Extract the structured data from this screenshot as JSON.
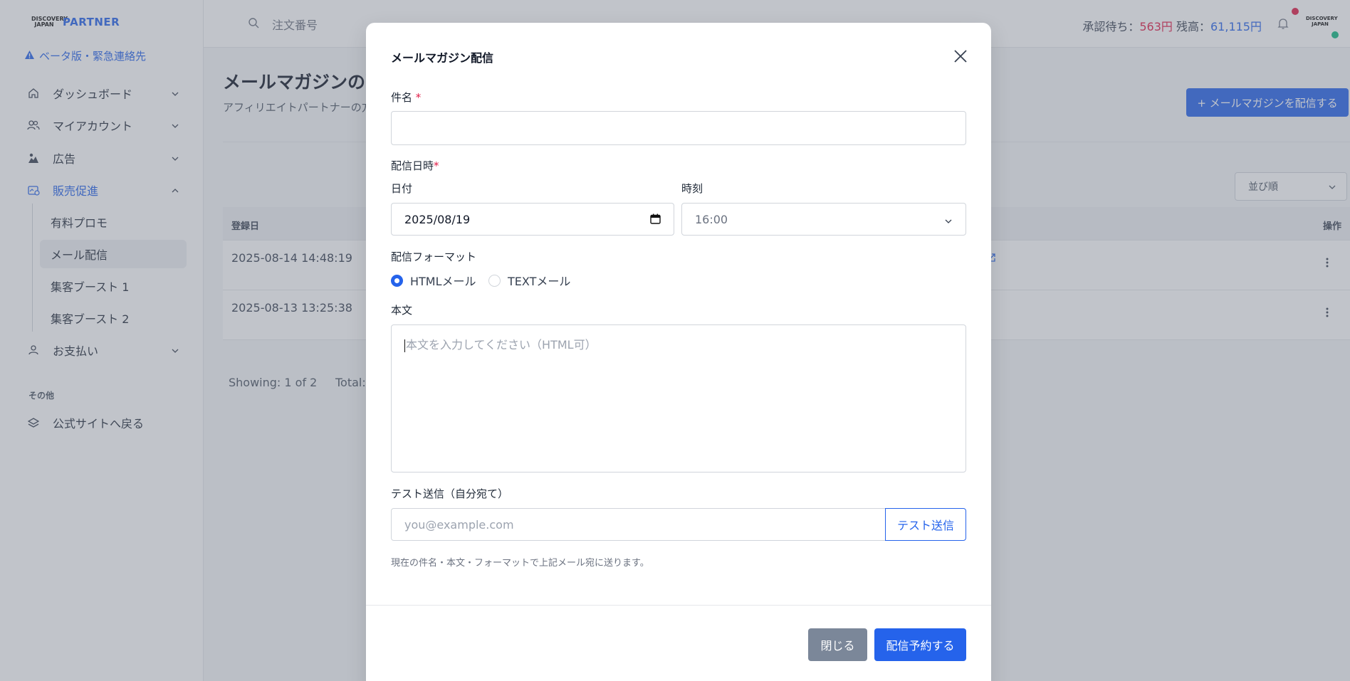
{
  "brand": {
    "logo_mark": "DISCOVERY JAPAN",
    "logo_text": "PARTNER"
  },
  "sidebar": {
    "beta_link": "ベータ版・緊急連絡先",
    "items": [
      {
        "label": "ダッシュボード",
        "icon": "home-icon"
      },
      {
        "label": "マイアカウント",
        "icon": "users-icon"
      },
      {
        "label": "広告",
        "icon": "image-icon"
      },
      {
        "label": "販売促進",
        "icon": "promo-icon"
      },
      {
        "label": "お支払い",
        "icon": "user-icon"
      }
    ],
    "sub_items": [
      {
        "label": "有料プロモ"
      },
      {
        "label": "メール配信"
      },
      {
        "label": "集客ブースト 1"
      },
      {
        "label": "集客ブースト 2"
      }
    ],
    "section_other": "その他",
    "official_site": "公式サイトへ戻る"
  },
  "topbar": {
    "search_placeholder": "注文番号",
    "pending_label": "承認待ち：",
    "pending_value": "563円",
    "balance_label": "残高：",
    "balance_value": "61,115円"
  },
  "main": {
    "title": "メールマガジンの配",
    "subtitle": "アフィリエイトパートナーの方",
    "new_button": "+ メールマガジンを配信する",
    "sort_label": "並び順",
    "table": {
      "col_date": "登録日",
      "col_ops": "操作",
      "rows": [
        {
          "date": "2025-08-14 14:48:19"
        },
        {
          "date": "2025-08-13 13:25:38"
        }
      ]
    },
    "showing": "Showing: 1 of 2",
    "total": "Total:"
  },
  "modal": {
    "title": "メールマガジン配信",
    "subject_label": "件名",
    "subject_required": "*",
    "schedule_label": "配信日時",
    "schedule_required": "*",
    "date_label": "日付",
    "date_value": "2025/08/19",
    "time_label": "時刻",
    "time_value": "16:00",
    "format_label": "配信フォーマット",
    "format_options": [
      {
        "label": "HTMLメール",
        "checked": true
      },
      {
        "label": "TEXTメール",
        "checked": false
      }
    ],
    "body_label": "本文",
    "body_placeholder": "本文を入力してください（HTML可）",
    "test_label": "テスト送信（自分宛て）",
    "test_placeholder": "you@example.com",
    "test_button": "テスト送信",
    "test_hint": "現在の件名・本文・フォーマットで上記メール宛に送ります。",
    "close_button": "閉じる",
    "submit_button": "配信予約する"
  },
  "colors": {
    "accent": "#2563eb",
    "danger": "#e11d48",
    "success": "#10b981",
    "muted_button": "#7b8799"
  }
}
